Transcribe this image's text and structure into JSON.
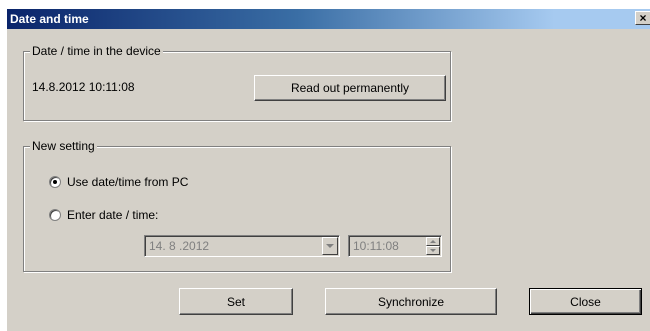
{
  "window": {
    "title": "Date and time",
    "close_glyph": "×"
  },
  "device_group": {
    "legend": "Date / time in the device",
    "datetime_value": "14.8.2012 10:11:08",
    "read_button_label": "Read out permanently"
  },
  "new_setting_group": {
    "legend": "New setting",
    "radio_pc_label": "Use date/time from PC",
    "radio_pc_checked": true,
    "radio_enter_label": "Enter date / time:",
    "radio_enter_checked": false,
    "date_value": "14. 8 .2012",
    "time_value": "10:11:08"
  },
  "buttons": {
    "set_label": "Set",
    "sync_label": "Synchronize",
    "close_label": "Close"
  },
  "colors": {
    "dialog_face": "#d4d0c8",
    "title_start": "#0a246a",
    "title_end": "#a6caf0",
    "disabled_text": "#808080"
  }
}
